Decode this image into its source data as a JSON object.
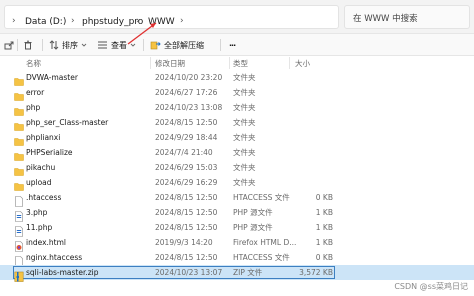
{
  "address_bar": {
    "crumbs": [
      "Data (D:)",
      "phpstudy_pro",
      "WWW"
    ],
    "search_placeholder": "在 WWW 中搜索"
  },
  "toolbar": {
    "sort_label": "排序",
    "view_label": "查看",
    "extract_all_label": "全部解压缩",
    "more_label": "···"
  },
  "columns": [
    "名称",
    "修改日期",
    "类型",
    "大小"
  ],
  "files": [
    {
      "name": "DVWA-master",
      "date": "2024/10/20 23:20",
      "type": "文件夹",
      "size": "",
      "icon": "folder-icon"
    },
    {
      "name": "error",
      "date": "2024/6/27 17:26",
      "type": "文件夹",
      "size": "",
      "icon": "folder-icon"
    },
    {
      "name": "php",
      "date": "2024/10/23 13:08",
      "type": "文件夹",
      "size": "",
      "icon": "folder-icon"
    },
    {
      "name": "php_ser_Class-master",
      "date": "2024/8/15 12:50",
      "type": "文件夹",
      "size": "",
      "icon": "folder-icon"
    },
    {
      "name": "phplianxi",
      "date": "2024/9/29 18:44",
      "type": "文件夹",
      "size": "",
      "icon": "folder-icon"
    },
    {
      "name": "PHPSerialize",
      "date": "2024/7/4 21:40",
      "type": "文件夹",
      "size": "",
      "icon": "folder-icon"
    },
    {
      "name": "pikachu",
      "date": "2024/6/29 15:03",
      "type": "文件夹",
      "size": "",
      "icon": "folder-icon"
    },
    {
      "name": "upload",
      "date": "2024/6/29 16:29",
      "type": "文件夹",
      "size": "",
      "icon": "folder-icon"
    },
    {
      "name": ".htaccess",
      "date": "2024/8/15 12:50",
      "type": "HTACCESS 文件",
      "size": "0 KB",
      "icon": "file-icon"
    },
    {
      "name": "3.php",
      "date": "2024/8/15 12:50",
      "type": "PHP 源文件",
      "size": "1 KB",
      "icon": "php-file-icon"
    },
    {
      "name": "11.php",
      "date": "2024/8/15 12:50",
      "type": "PHP 源文件",
      "size": "1 KB",
      "icon": "php-file-icon"
    },
    {
      "name": "index.html",
      "date": "2019/9/3 14:20",
      "type": "Firefox HTML D...",
      "size": "1 KB",
      "icon": "html-file-icon"
    },
    {
      "name": "nginx.htaccess",
      "date": "2024/8/15 12:50",
      "type": "HTACCESS 文件",
      "size": "0 KB",
      "icon": "file-icon"
    },
    {
      "name": "sqli-labs-master.zip",
      "date": "2024/10/23 13:07",
      "type": "ZIP 文件",
      "size": "3,572 KB",
      "icon": "zip-file-icon",
      "selected": true
    }
  ],
  "watermark": "CSDN @ss菜鸡日记",
  "colors": {
    "accent": "#3c7fc1",
    "selection": "#cce4f7",
    "folder": "#f5c344",
    "arrow": "#e03030"
  }
}
